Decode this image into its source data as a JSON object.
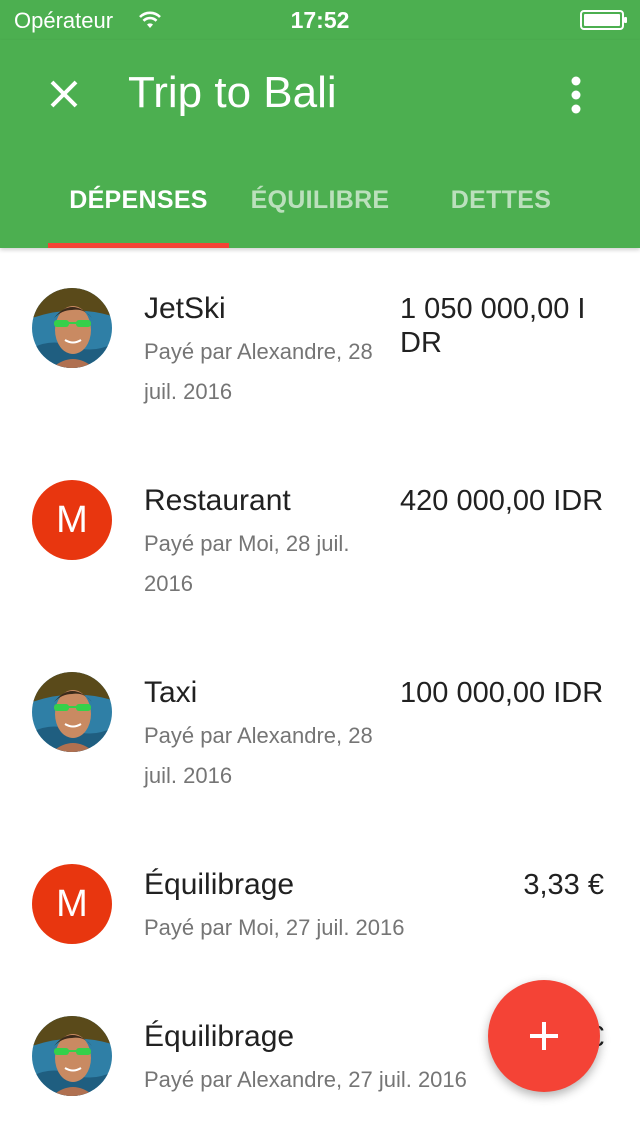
{
  "status_bar": {
    "carrier": "Opérateur",
    "time": "17:52"
  },
  "app_bar": {
    "title": "Trip to Bali",
    "close_icon": "close-icon",
    "more_icon": "more-vert-icon"
  },
  "tabs": [
    {
      "label": "DÉPENSES",
      "active": true
    },
    {
      "label": "ÉQUILIBRE",
      "active": false
    },
    {
      "label": "DETTES",
      "active": false
    }
  ],
  "expenses": [
    {
      "title": "JetSki",
      "subtitle": "Payé par Alexandre, 28 juil. 2016",
      "amount": "1 050 000,00 IDR",
      "avatar": "photo"
    },
    {
      "title": "Restaurant",
      "subtitle": "Payé par Moi, 28 juil. 2016",
      "amount": "420 000,00 IDR",
      "avatar": "M"
    },
    {
      "title": "Taxi",
      "subtitle": "Payé par Alexandre, 28 juil. 2016",
      "amount": "100 000,00 IDR",
      "avatar": "photo"
    },
    {
      "title": "Équilibrage",
      "subtitle": "Payé par Moi, 27 juil. 2016",
      "amount": "3,33 €",
      "avatar": "M"
    },
    {
      "title": "Équilibrage",
      "subtitle": "Payé par Alexandre, 27 juil. 2016",
      "amount": "€",
      "avatar": "photo"
    }
  ],
  "fab": {
    "icon": "plus-icon"
  },
  "colors": {
    "primary": "#4caf50",
    "accent": "#f44336",
    "avatar_letter_bg": "#e8360f"
  }
}
